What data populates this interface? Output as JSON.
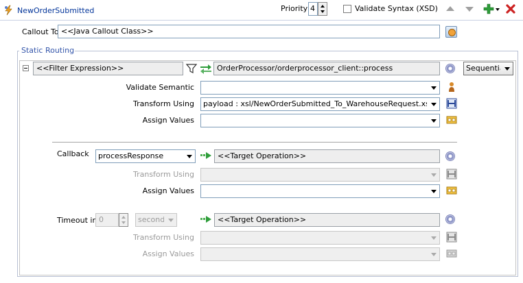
{
  "header": {
    "title": "NewOrderSubmitted",
    "priority_label": "Priority",
    "priority_value": "4",
    "validate_syntax_label": "Validate Syntax (XSD)",
    "validate_syntax_checked": false
  },
  "callout": {
    "label": "Callout To",
    "value": "<<Java Callout Class>>"
  },
  "static_routing": {
    "title": "Static Routing",
    "filter_expression": "<<Filter Expression>>",
    "target_service": "OrderProcessor/orderprocessor_client::process",
    "execution_mode": "Sequential",
    "validate_semantic_label": "Validate Semantic",
    "validate_semantic_value": "",
    "transform_using_label": "Transform Using",
    "transform_using_value": "payload : xsl/NewOrderSubmitted_To_WarehouseRequest.xsl",
    "assign_values_label": "Assign Values",
    "assign_values_value": ""
  },
  "callback": {
    "label": "Callback",
    "operation": "processResponse",
    "target_operation": "<<Target Operation>>",
    "transform_using_label": "Transform Using",
    "transform_using_value": "",
    "assign_values_label": "Assign Values",
    "assign_values_value": ""
  },
  "timeout": {
    "label": "Timeout in",
    "value": "0",
    "unit": "seconds",
    "target_operation": "<<Target Operation>>",
    "transform_using_label": "Transform Using",
    "transform_using_value": "",
    "assign_values_label": "Assign Values",
    "assign_values_value": ""
  },
  "colors": {
    "title_blue": "#003399",
    "group_title_blue": "#3355aa",
    "add_green": "#2e9d3a",
    "delete_red": "#cc2222"
  }
}
